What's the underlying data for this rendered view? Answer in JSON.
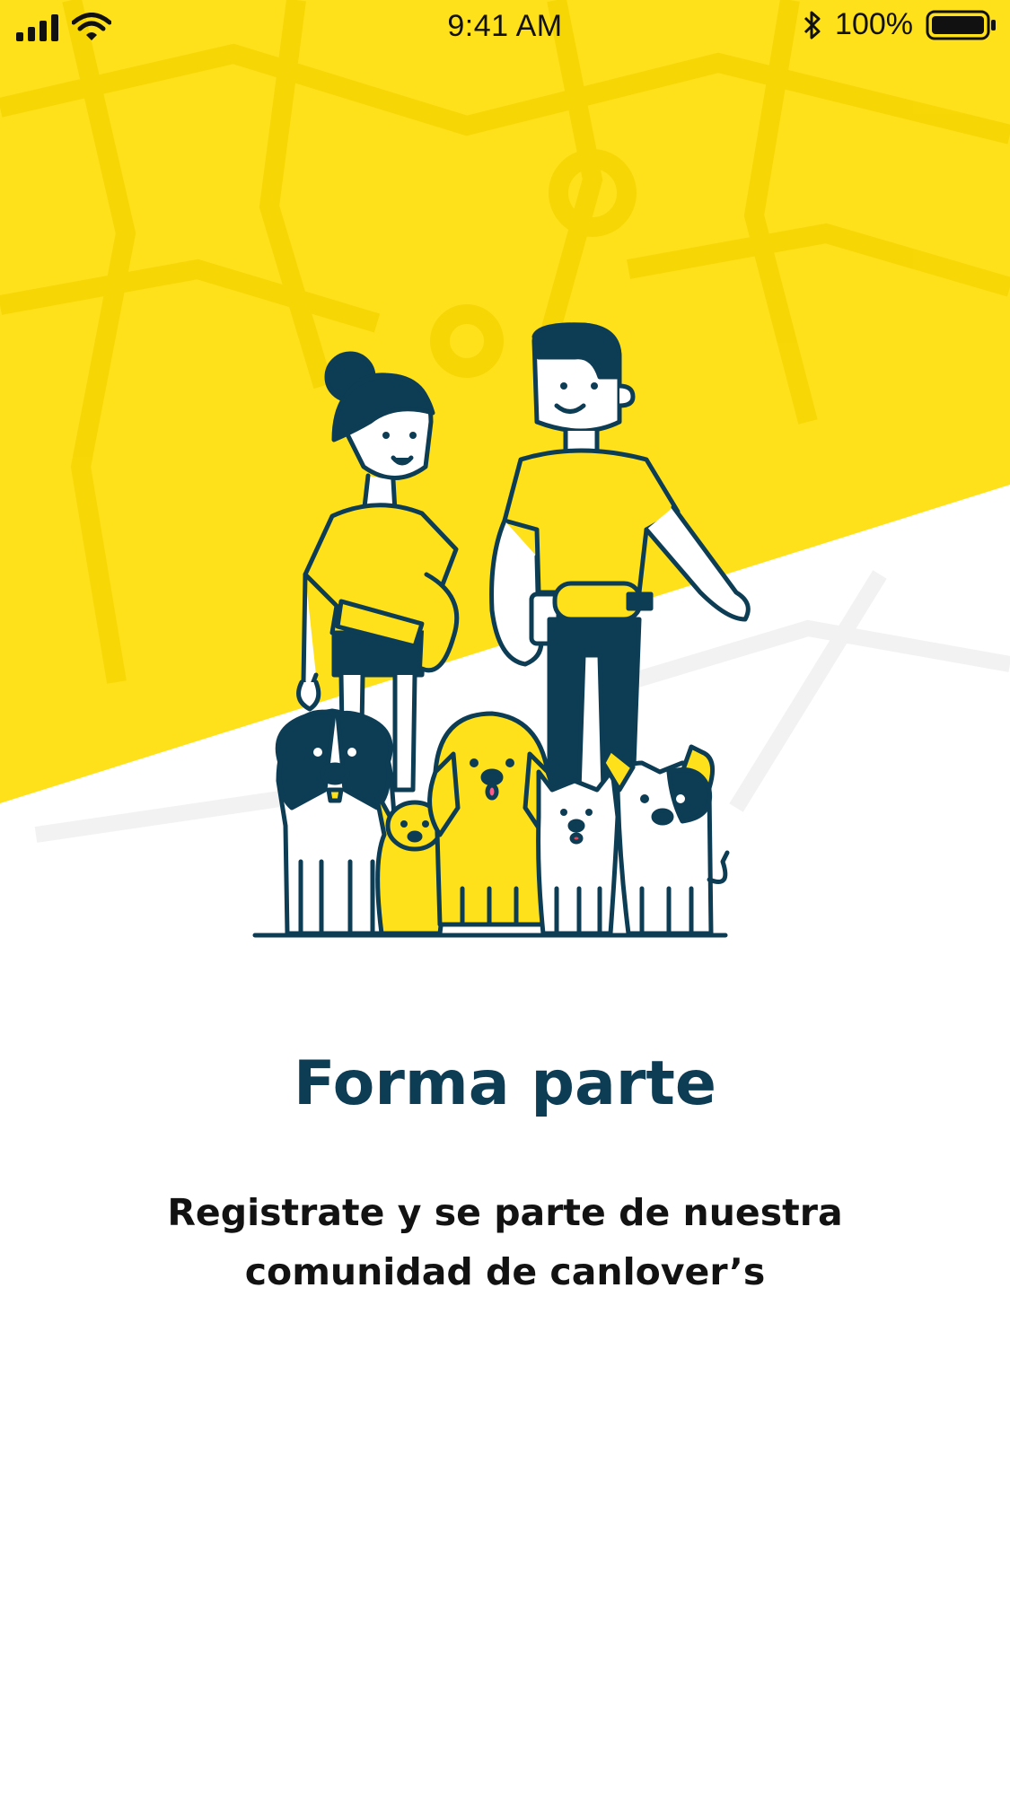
{
  "status_bar": {
    "time": "9:41 AM",
    "battery_percent": "100%",
    "icons": [
      "signal-icon",
      "wifi-icon",
      "bluetooth-icon",
      "battery-icon"
    ]
  },
  "onboarding": {
    "title": "Forma parte",
    "subtitle": "Registrate y se parte de nuestra comunidad de canlover’s",
    "illustration": "people-with-dogs-illustration"
  },
  "colors": {
    "brand_yellow": "#FFE11B",
    "navy": "#0D3C55",
    "text_dark": "#121212",
    "background": "#FFFFFF"
  }
}
